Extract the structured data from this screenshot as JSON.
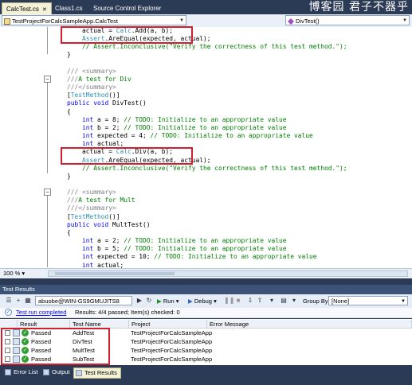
{
  "watermark": "博客园 君子不器乎",
  "tabs": [
    {
      "label": "CalcTest.cs",
      "active": true
    },
    {
      "label": "Class1.cs",
      "active": false
    },
    {
      "label": "Source Control Explorer",
      "active": false
    }
  ],
  "navbar": {
    "class_selector": "TestProjectForCalcSampleApp.CalcTest",
    "member_selector": "DivTest()"
  },
  "editor": {
    "zoom": "100 %",
    "lines": [
      [
        [
          "",
          "        actual = "
        ],
        [
          "ty",
          "Calc"
        ],
        [
          "",
          ".Add(a, b);"
        ]
      ],
      [
        [
          "",
          "        "
        ],
        [
          "ty",
          "Assert"
        ],
        [
          "",
          ".AreEqual(expected, actual);"
        ]
      ],
      [
        [
          "cm",
          "        // Assert.Inconclusive(\"Verify the correctness of this test method.\");"
        ]
      ],
      [
        [
          "",
          "    }"
        ]
      ],
      [
        [
          "",
          ""
        ]
      ],
      [
        [
          "dc",
          "    /// <summary>"
        ]
      ],
      [
        [
          "dc",
          "    ///"
        ],
        [
          "cm",
          "A test for Div"
        ]
      ],
      [
        [
          "dc",
          "    ///</summary>"
        ]
      ],
      [
        [
          "",
          "    ["
        ],
        [
          "ty",
          "TestMethod"
        ],
        [
          "",
          "()]"
        ]
      ],
      [
        [
          "kw",
          "    public void "
        ],
        [
          "",
          "DivTest()"
        ]
      ],
      [
        [
          "",
          "    {"
        ]
      ],
      [
        [
          "kw",
          "        int "
        ],
        [
          "",
          "a = 8; "
        ],
        [
          "cm",
          "// TODO: Initialize to an appropriate value"
        ]
      ],
      [
        [
          "kw",
          "        int "
        ],
        [
          "",
          "b = 2; "
        ],
        [
          "cm",
          "// TODO: Initialize to an appropriate value"
        ]
      ],
      [
        [
          "kw",
          "        int "
        ],
        [
          "",
          "expected = 4; "
        ],
        [
          "cm",
          "// TODO: Initialize to an appropriate value"
        ]
      ],
      [
        [
          "kw",
          "        int "
        ],
        [
          "",
          "actual;"
        ]
      ],
      [
        [
          "",
          "        actual = "
        ],
        [
          "ty",
          "Calc"
        ],
        [
          "",
          ".Div(a, b);"
        ]
      ],
      [
        [
          "",
          "        "
        ],
        [
          "ty",
          "Assert"
        ],
        [
          "",
          ".AreEqual(expected, actual);"
        ]
      ],
      [
        [
          "cm",
          "        // Assert.Inconclusive(\"Verify the correctness of this test method.\");"
        ]
      ],
      [
        [
          "",
          "    }"
        ]
      ],
      [
        [
          "",
          ""
        ]
      ],
      [
        [
          "dc",
          "    /// <summary>"
        ]
      ],
      [
        [
          "dc",
          "    ///"
        ],
        [
          "cm",
          "A test for Mult"
        ]
      ],
      [
        [
          "dc",
          "    ///</summary>"
        ]
      ],
      [
        [
          "",
          "    ["
        ],
        [
          "ty",
          "TestMethod"
        ],
        [
          "",
          "()]"
        ]
      ],
      [
        [
          "kw",
          "    public void "
        ],
        [
          "",
          "MultTest()"
        ]
      ],
      [
        [
          "",
          "    {"
        ]
      ],
      [
        [
          "kw",
          "        int "
        ],
        [
          "",
          "a = 2; "
        ],
        [
          "cm",
          "// TODO: Initialize to an appropriate value"
        ]
      ],
      [
        [
          "kw",
          "        int "
        ],
        [
          "",
          "b = 5; "
        ],
        [
          "cm",
          "// TODO: Initialize to an appropriate value"
        ]
      ],
      [
        [
          "kw",
          "        int "
        ],
        [
          "",
          "expected = 10; "
        ],
        [
          "cm",
          "// TODO: Initialize to an appropriate value"
        ]
      ],
      [
        [
          "kw",
          "        int "
        ],
        [
          "",
          "actual;"
        ]
      ]
    ]
  },
  "test_results": {
    "title": "Test Results",
    "run_selector": "abuobe@WIN-GS9GMUJITS8 2010-0",
    "run_label": "Run",
    "debug_label": "Debug",
    "group_by_label": "Group By:",
    "group_by_value": "[None]",
    "status_link": "Test run completed",
    "status_text": "Results: 4/4 passed;  Item(s) checked: 0",
    "columns": [
      "Result",
      "Test Name",
      "Project",
      "Error Message"
    ],
    "rows": [
      {
        "result": "Passed",
        "name": "AddTest",
        "project": "TestProjectForCalcSampleApp",
        "error": ""
      },
      {
        "result": "Passed",
        "name": "DivTest",
        "project": "TestProjectForCalcSampleApp",
        "error": ""
      },
      {
        "result": "Passed",
        "name": "MultTest",
        "project": "TestProjectForCalcSampleApp",
        "error": ""
      },
      {
        "result": "Passed",
        "name": "SubTest",
        "project": "TestProjectForCalcSampleApp",
        "error": ""
      }
    ]
  },
  "bottom_tabs": [
    {
      "label": "Error List",
      "active": false
    },
    {
      "label": "Output",
      "active": false
    },
    {
      "label": "Test Results",
      "active": true
    }
  ],
  "colors": {
    "keyword": "#0000ff",
    "type": "#2b91af",
    "comment": "#008000",
    "highlight_box": "#d0202e",
    "passed_icon": "#2fa02f"
  }
}
